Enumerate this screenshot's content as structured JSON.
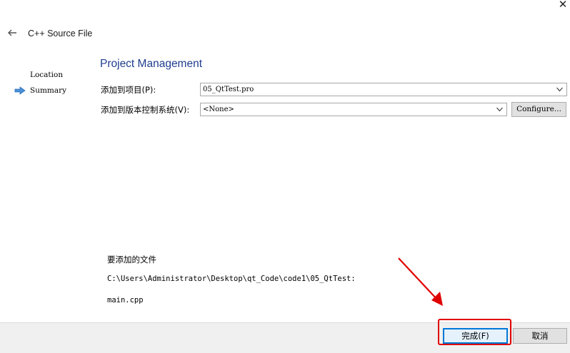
{
  "window": {
    "close_label": "✕"
  },
  "wizard": {
    "title": "C++ Source File"
  },
  "steps": [
    {
      "label": "Location",
      "current": false
    },
    {
      "label": "Summary",
      "current": true
    }
  ],
  "page": {
    "title": "Project Management",
    "add_to_project_label": "添加到项目(P):",
    "add_to_project_value": "05_QtTest.pro",
    "add_to_vcs_label": "添加到版本控制系统(V):",
    "add_to_vcs_value": "<None>",
    "configure_label": "Configure..."
  },
  "files": {
    "heading": "要添加的文件",
    "path": "C:\\Users\\Administrator\\Desktop\\qt_Code\\code1\\05_QtTest:",
    "items": [
      "main.cpp"
    ]
  },
  "footer": {
    "finish_label": "完成(F)",
    "cancel_label": "取消"
  },
  "colors": {
    "title_blue": "#1f3d8f",
    "annotation_red": "#e00000",
    "default_button_border": "#0078d7"
  }
}
